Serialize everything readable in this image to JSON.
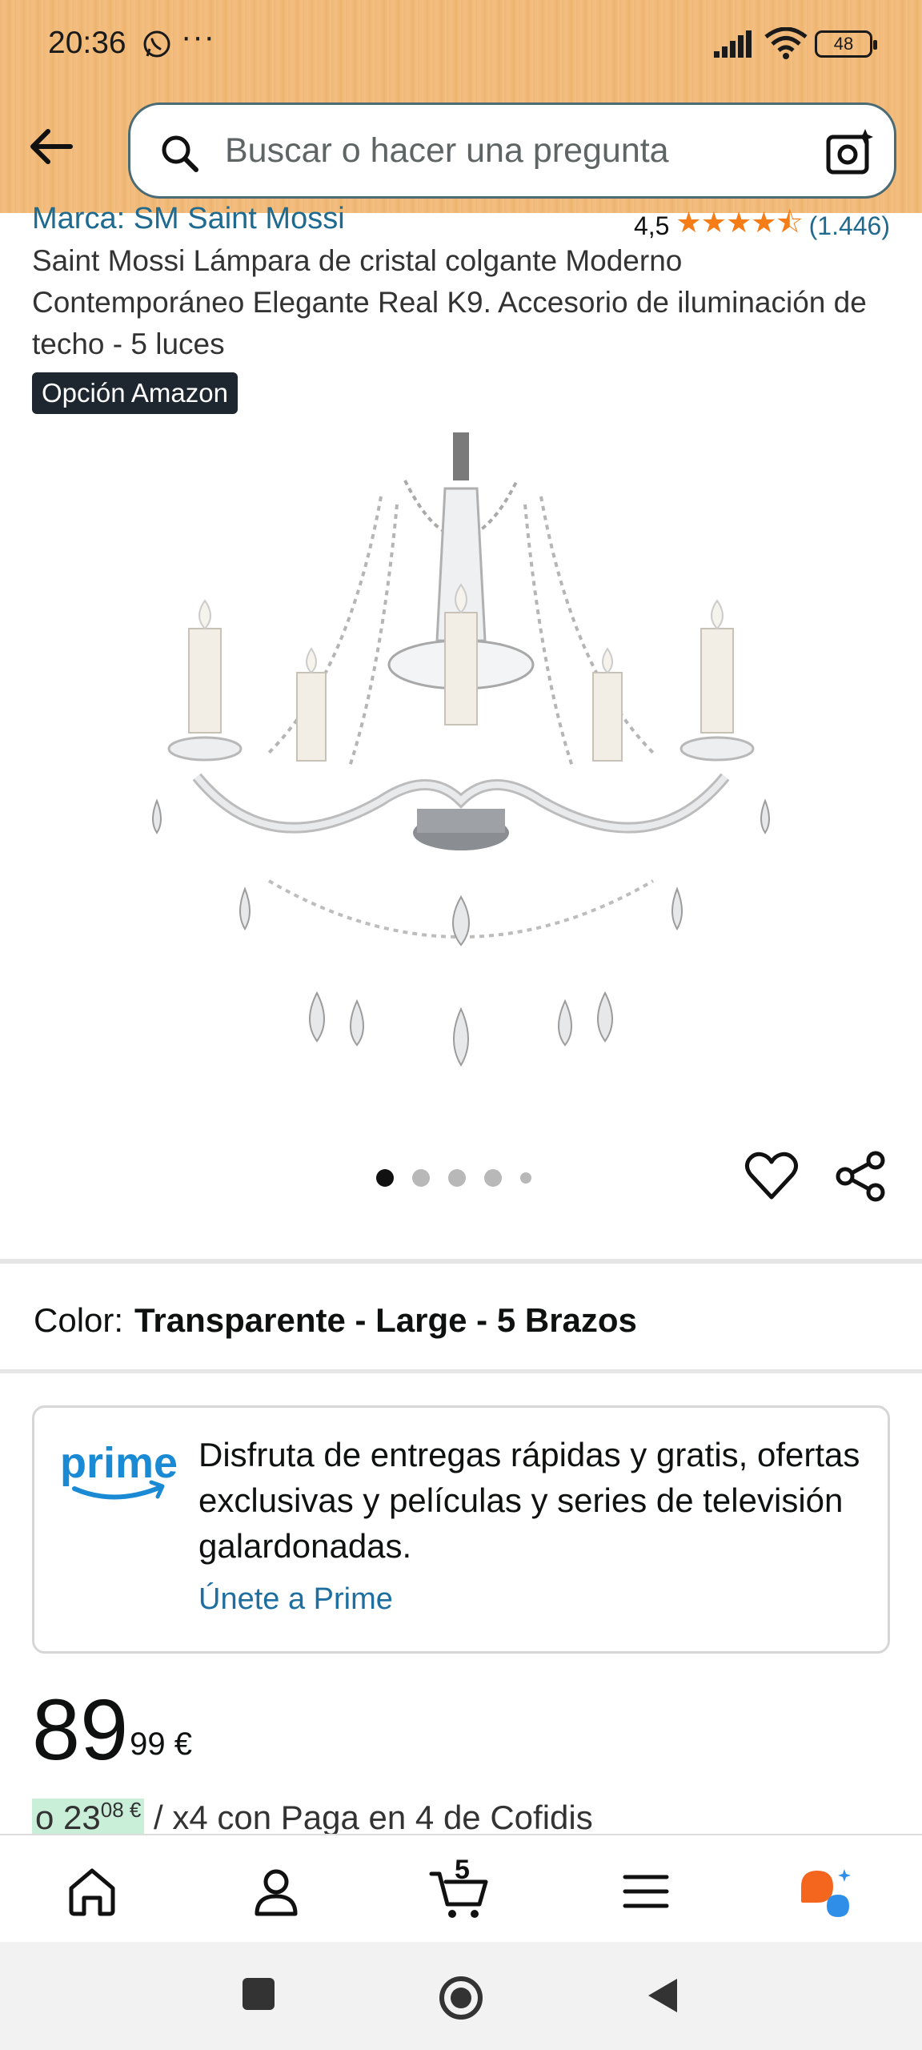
{
  "status_bar": {
    "time": "20:36",
    "more": "···",
    "battery": "48"
  },
  "search": {
    "placeholder": "Buscar o hacer una pregunta"
  },
  "product": {
    "brand": "Marca: SM Saint Mossi",
    "rating_value": "4,5",
    "rating_stars": "★★★★⯪",
    "rating_count": "(1.446)",
    "title": "Saint Mossi Lámpara de cristal colgante Moderno Contemporáneo Elegante Real K9. Accesorio de iluminación de techo - 5 luces",
    "badge": "Opción Amazon",
    "image_count": 5,
    "active_image": 1
  },
  "color": {
    "label": "Color:",
    "value": "Transparente - Large - 5 Brazos"
  },
  "prime": {
    "logo_text": "prime",
    "text": "Disfruta de entregas rápidas y gratis, ofertas exclusivas y películas y series de televisión galardonadas.",
    "link": "Únete a Prime"
  },
  "price": {
    "whole": "89",
    "fraction": "99 €"
  },
  "cofidis": {
    "highlight": "o 23",
    "fraction": "08 €",
    "rest": " / x4 con Paga en 4 de Cofidis"
  },
  "bottom_nav": {
    "cart_count": "5",
    "items": [
      "home-icon",
      "account-icon",
      "cart-icon",
      "menu-icon",
      "rufus-icon"
    ]
  },
  "colors": {
    "header": "#f0b877",
    "link": "#1f6a8f",
    "star": "#f57c16",
    "badge_bg": "#1e2730",
    "prime_blue": "#1e6fa0",
    "rufus_orange": "#f4651e",
    "rufus_blue": "#2f8ee8"
  }
}
